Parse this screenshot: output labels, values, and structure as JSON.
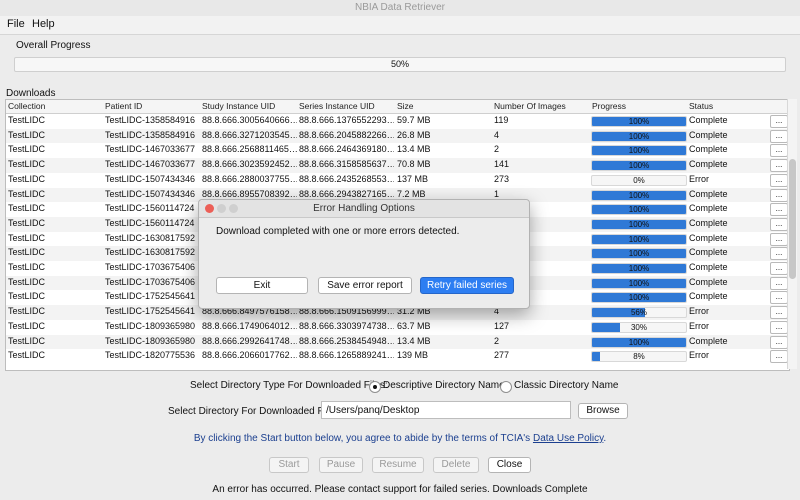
{
  "window": {
    "title": "NBIA Data Retriever"
  },
  "menu": {
    "file": "File",
    "help": "Help"
  },
  "overall": {
    "label": "Overall Progress",
    "progress": 0.5,
    "progress_text": "50%"
  },
  "downloads": {
    "label": "Downloads",
    "columns": [
      "Collection",
      "Patient ID",
      "Study Instance UID",
      "Series Instance UID",
      "Size",
      "Number Of Images",
      "Progress",
      "Status"
    ],
    "rows": [
      {
        "collection": "TestLIDC",
        "patient": "TestLIDC-1358584916",
        "study": "88.8.666.3005640666…",
        "series": "88.8.666.1376552293…",
        "size": "59.7 MB",
        "images": "119",
        "progress": 1.0,
        "progress_text": "100%",
        "status": "Complete",
        "action": "..."
      },
      {
        "collection": "TestLIDC",
        "patient": "TestLIDC-1358584916",
        "study": "88.8.666.3271203545…",
        "series": "88.8.666.2045882266…",
        "size": "26.8 MB",
        "images": "4",
        "progress": 1.0,
        "progress_text": "100%",
        "status": "Complete",
        "action": "..."
      },
      {
        "collection": "TestLIDC",
        "patient": "TestLIDC-1467033677",
        "study": "88.8.666.2568811465…",
        "series": "88.8.666.2464369180…",
        "size": "13.4 MB",
        "images": "2",
        "progress": 1.0,
        "progress_text": "100%",
        "status": "Complete",
        "action": "..."
      },
      {
        "collection": "TestLIDC",
        "patient": "TestLIDC-1467033677",
        "study": "88.8.666.3023592452…",
        "series": "88.8.666.3158585637…",
        "size": "70.8 MB",
        "images": "141",
        "progress": 1.0,
        "progress_text": "100%",
        "status": "Complete",
        "action": "..."
      },
      {
        "collection": "TestLIDC",
        "patient": "TestLIDC-1507434346",
        "study": "88.8.666.2880037755…",
        "series": "88.8.666.2435268553…",
        "size": "137 MB",
        "images": "273",
        "progress": 0.0,
        "progress_text": "0%",
        "status": "Error",
        "action": "..."
      },
      {
        "collection": "TestLIDC",
        "patient": "TestLIDC-1507434346",
        "study": "88.8.666.8955708392…",
        "series": "88.8.666.2943827165…",
        "size": "7.2 MB",
        "images": "1",
        "progress": 1.0,
        "progress_text": "100%",
        "status": "Complete",
        "action": "..."
      },
      {
        "collection": "TestLIDC",
        "patient": "TestLIDC-1560114724",
        "study": "",
        "series": "",
        "size": "",
        "images": "",
        "progress": 1.0,
        "progress_text": "100%",
        "status": "Complete",
        "action": "..."
      },
      {
        "collection": "TestLIDC",
        "patient": "TestLIDC-1560114724",
        "study": "",
        "series": "",
        "size": "",
        "images": "",
        "progress": 1.0,
        "progress_text": "100%",
        "status": "Complete",
        "action": "..."
      },
      {
        "collection": "TestLIDC",
        "patient": "TestLIDC-1630817592",
        "study": "",
        "series": "",
        "size": "",
        "images": "",
        "progress": 1.0,
        "progress_text": "100%",
        "status": "Complete",
        "action": "..."
      },
      {
        "collection": "TestLIDC",
        "patient": "TestLIDC-1630817592",
        "study": "",
        "series": "",
        "size": "",
        "images": "",
        "progress": 1.0,
        "progress_text": "100%",
        "status": "Complete",
        "action": "..."
      },
      {
        "collection": "TestLIDC",
        "patient": "TestLIDC-1703675406",
        "study": "",
        "series": "",
        "size": "",
        "images": "",
        "progress": 1.0,
        "progress_text": "100%",
        "status": "Complete",
        "action": "..."
      },
      {
        "collection": "TestLIDC",
        "patient": "TestLIDC-1703675406",
        "study": "",
        "series": "",
        "size": "",
        "images": "",
        "progress": 1.0,
        "progress_text": "100%",
        "status": "Complete",
        "action": "..."
      },
      {
        "collection": "TestLIDC",
        "patient": "TestLIDC-1752545641",
        "study": "",
        "series": "",
        "size": "",
        "images": "",
        "progress": 1.0,
        "progress_text": "100%",
        "status": "Complete",
        "action": "..."
      },
      {
        "collection": "TestLIDC",
        "patient": "TestLIDC-1752545641",
        "study": "88.8.666.8497576158…",
        "series": "88.8.666.1509156999…",
        "size": "31.2 MB",
        "images": "4",
        "progress": 0.56,
        "progress_text": "56%",
        "status": "Error",
        "action": "..."
      },
      {
        "collection": "TestLIDC",
        "patient": "TestLIDC-1809365980",
        "study": "88.8.666.1749064012…",
        "series": "88.8.666.3303974738…",
        "size": "63.7 MB",
        "images": "127",
        "progress": 0.3,
        "progress_text": "30%",
        "status": "Error",
        "action": "..."
      },
      {
        "collection": "TestLIDC",
        "patient": "TestLIDC-1809365980",
        "study": "88.8.666.2992641748…",
        "series": "88.8.666.2538454948…",
        "size": "13.4 MB",
        "images": "2",
        "progress": 1.0,
        "progress_text": "100%",
        "status": "Complete",
        "action": "..."
      },
      {
        "collection": "TestLIDC",
        "patient": "TestLIDC-1820775536",
        "study": "88.8.666.2066017762…",
        "series": "88.8.666.1265889241…",
        "size": "139 MB",
        "images": "277",
        "progress": 0.08,
        "progress_text": "8%",
        "status": "Error",
        "action": "..."
      }
    ]
  },
  "dialog": {
    "title": "Error Handling Options",
    "message": "Download completed with one or more errors detected.",
    "exit": "Exit",
    "save": "Save error report",
    "retry": "Retry failed series"
  },
  "directory_type": {
    "label": "Select Directory Type For Downloaded Files:",
    "option_descriptive": "Descriptive Directory Name",
    "option_classic": "Classic Directory Name",
    "selected": "descriptive"
  },
  "directory": {
    "label": "Select Directory For Downloaded Files:",
    "value": "/Users/panq/Desktop",
    "browse": "Browse"
  },
  "terms": {
    "text": "By clicking the Start button below, you agree to abide by the terms of TCIA's",
    "link": "Data Use Policy",
    "end": "."
  },
  "controls": {
    "start": "Start",
    "pause": "Pause",
    "resume": "Resume",
    "delete": "Delete",
    "close": "Close"
  },
  "status": "An error has occurred. Please contact support for failed series. Downloads Complete",
  "colors": {
    "accent": "#2d7ef2",
    "progress": "#2f79d6",
    "close_red": "#ec5f57"
  }
}
